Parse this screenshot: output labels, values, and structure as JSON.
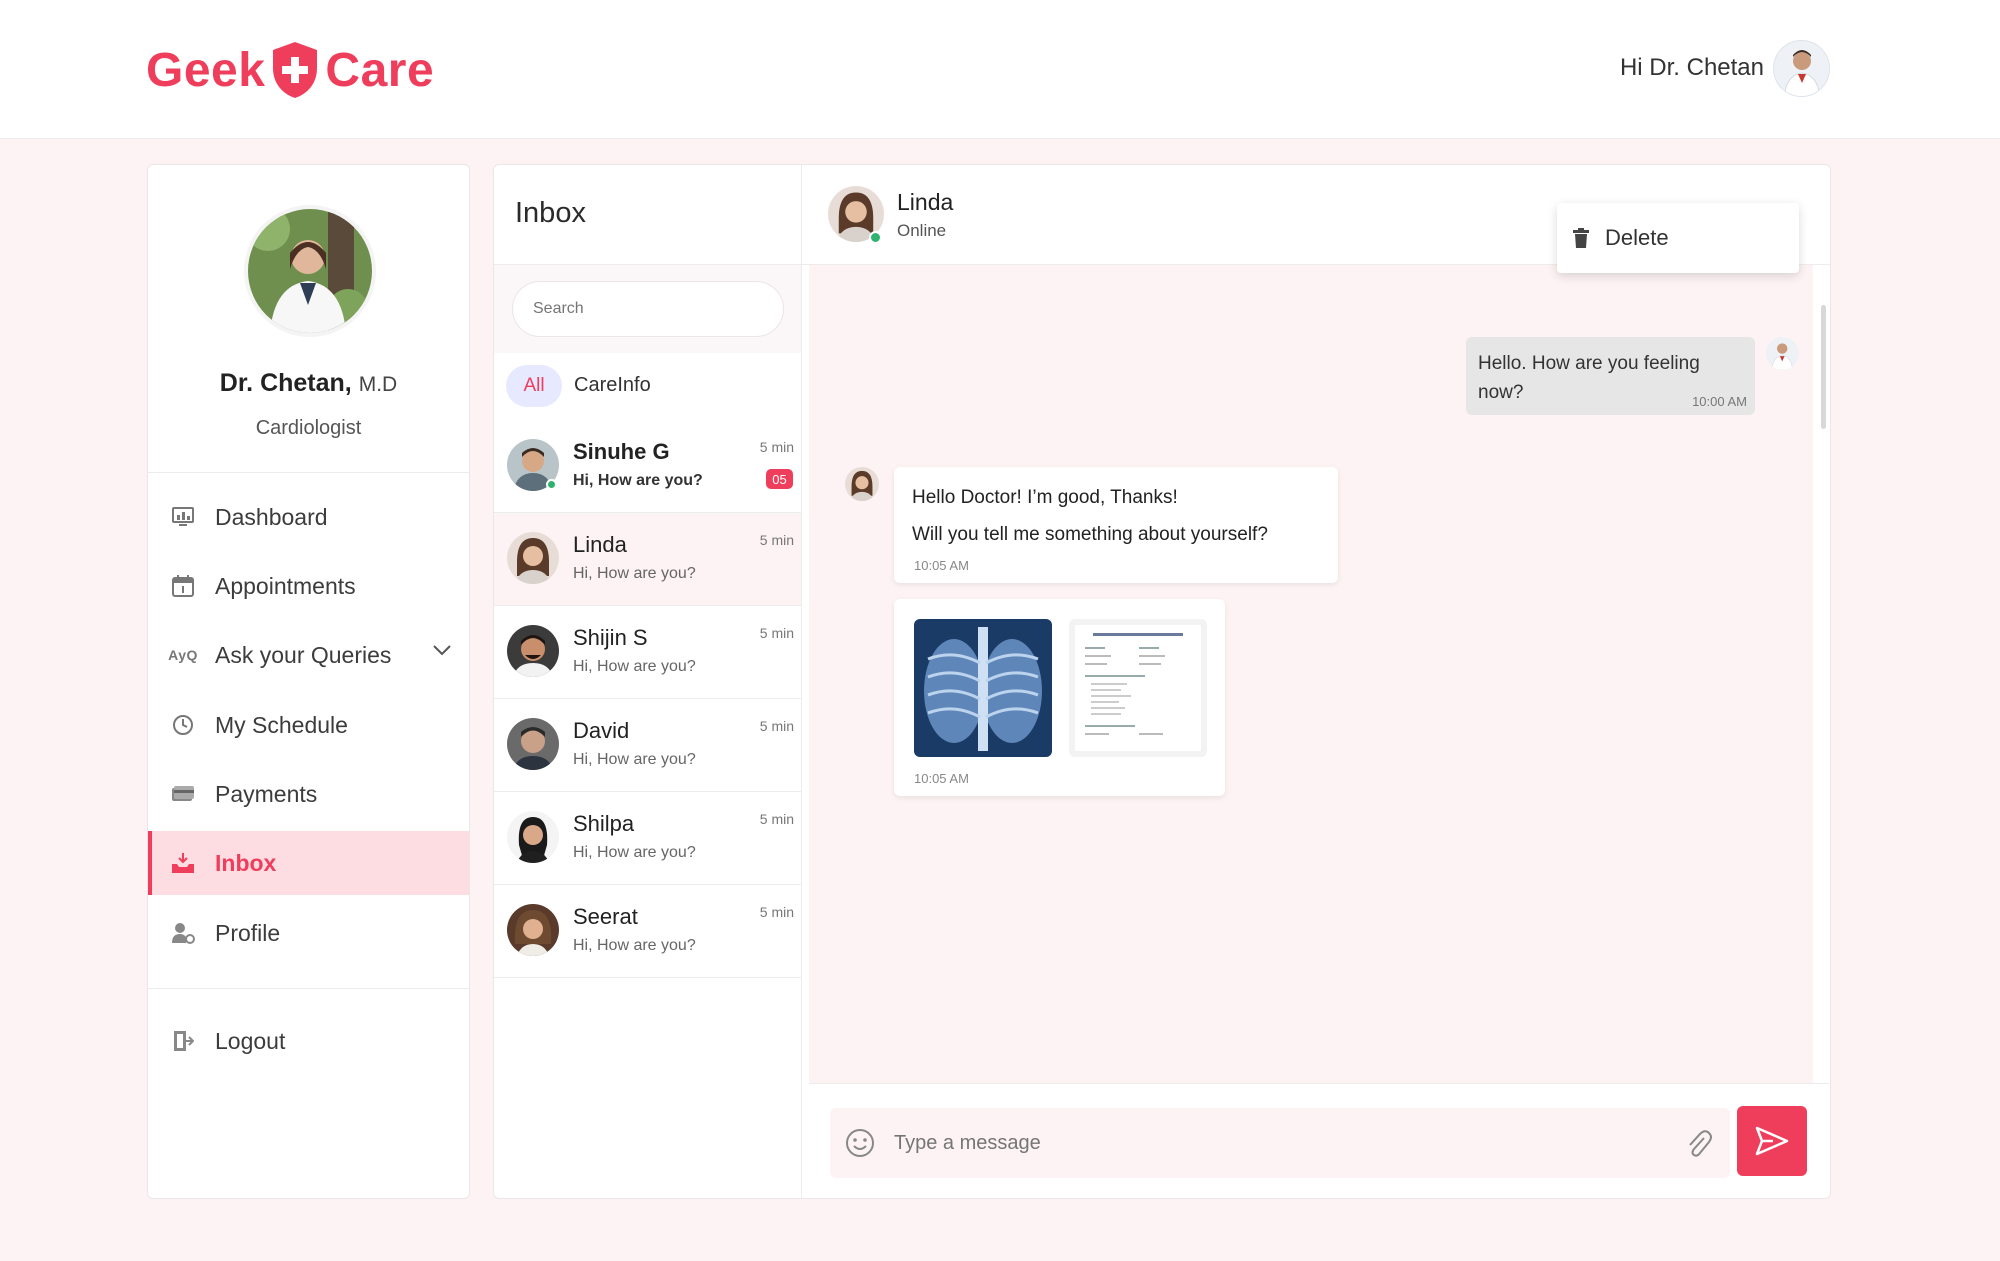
{
  "brand": {
    "part1": "Geek",
    "part2": "Care",
    "color": "#ef3e5c"
  },
  "header": {
    "greeting": "Hi Dr. Chetan"
  },
  "doctor": {
    "name": "Dr. Chetan,",
    "degree": "M.D",
    "role": "Cardiologist"
  },
  "nav": {
    "items": [
      {
        "label": "Dashboard",
        "icon": "dashboard-icon"
      },
      {
        "label": "Appointments",
        "icon": "calendar-icon"
      },
      {
        "label": "Ask your Queries",
        "icon": "ayq-icon",
        "icon_text": "AyQ"
      },
      {
        "label": "My Schedule",
        "icon": "clock-icon"
      },
      {
        "label": "Payments",
        "icon": "card-icon"
      },
      {
        "label": "Inbox",
        "icon": "inbox-icon"
      },
      {
        "label": "Profile",
        "icon": "profile-icon"
      }
    ],
    "active": "Inbox",
    "logout": "Logout"
  },
  "inbox": {
    "title": "Inbox",
    "search_placeholder": "Search",
    "filters": {
      "all": "All",
      "careinfo": "CareInfo"
    },
    "conversations": [
      {
        "name": "Sinuhe G",
        "message": "Hi, How are you?",
        "time": "5 min",
        "unread": "05",
        "online": true
      },
      {
        "name": "Linda",
        "message": "Hi, How are you?",
        "time": "5 min"
      },
      {
        "name": "Shijin S",
        "message": "Hi, How are you?",
        "time": "5 min"
      },
      {
        "name": "David",
        "message": "Hi, How are you?",
        "time": "5 min"
      },
      {
        "name": "Shilpa",
        "message": "Hi, How are you?",
        "time": "5 min"
      },
      {
        "name": "Seerat",
        "message": "Hi, How are you?",
        "time": "5 min"
      }
    ]
  },
  "chat": {
    "contact_name": "Linda",
    "contact_status": "Online",
    "menu": {
      "delete": "Delete"
    },
    "messages": {
      "out1": {
        "text": "Hello. How are you feeling now?",
        "time": "10:00 AM"
      },
      "in1": {
        "line1": "Hello Doctor! I’m good, Thanks!",
        "line2": "Will you tell me something about yourself?",
        "time": "10:05 AM"
      },
      "attachments": {
        "time": "10:05 AM"
      }
    },
    "composer": {
      "placeholder": "Type a message"
    }
  }
}
